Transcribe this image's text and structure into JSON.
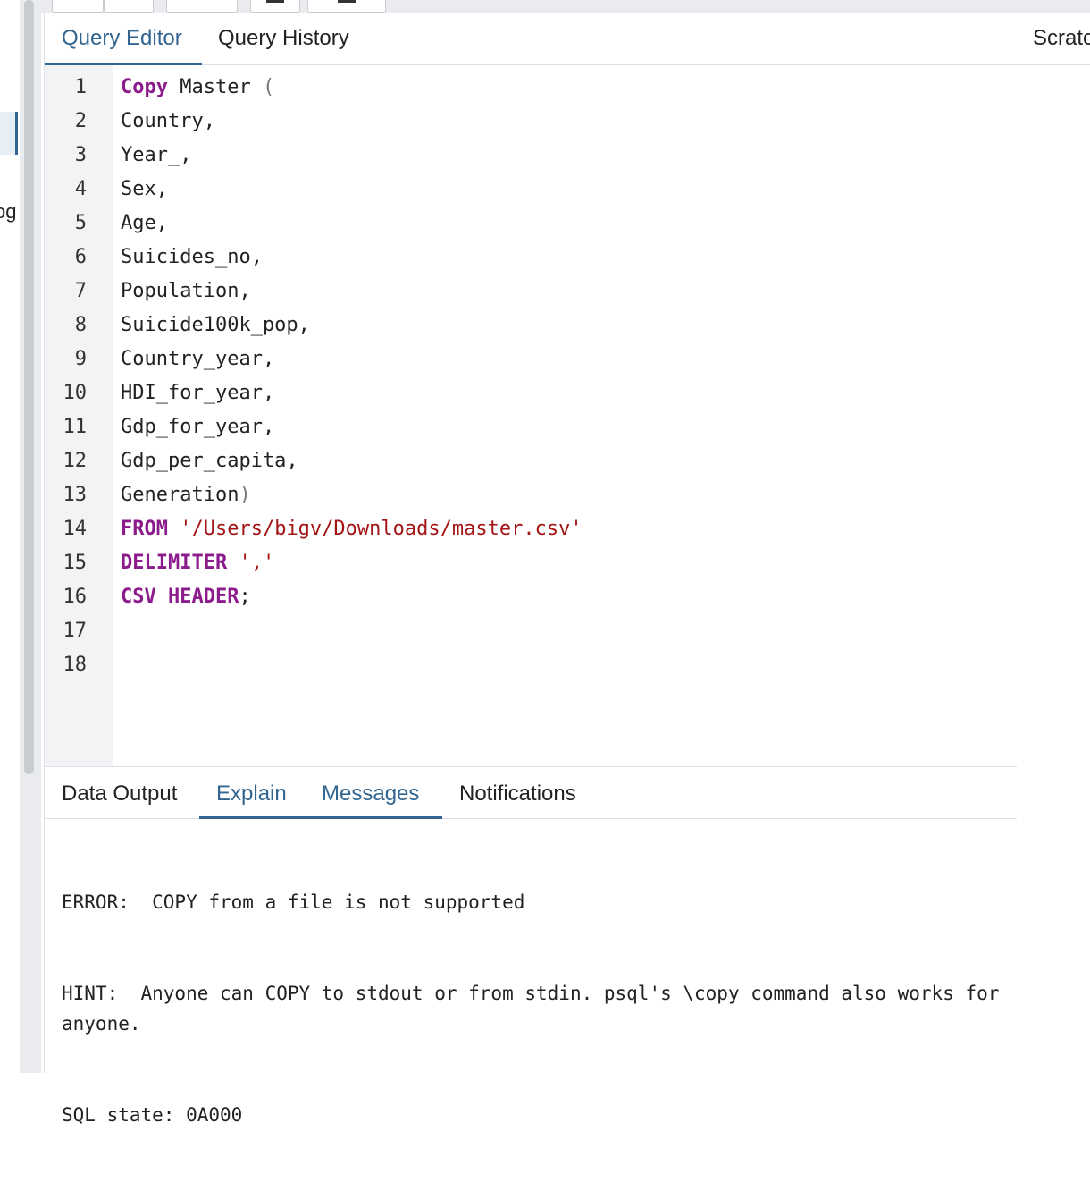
{
  "sidebar": {
    "partial_label": "og"
  },
  "tabs": [
    {
      "label": "Query Editor",
      "active": true
    },
    {
      "label": "Query History",
      "active": false
    }
  ],
  "scratch_pad": {
    "title": "Scratch Pad"
  },
  "editor": {
    "line_numbers": [
      "1",
      "2",
      "3",
      "4",
      "5",
      "6",
      "7",
      "8",
      "9",
      "10",
      "11",
      "12",
      "13",
      "14",
      "15",
      "16",
      "17",
      "18"
    ],
    "lines": [
      [
        {
          "t": "Copy",
          "c": "kw"
        },
        {
          "t": " Master ",
          "c": ""
        },
        {
          "t": "(",
          "c": "punc"
        }
      ],
      [
        {
          "t": "Country,",
          "c": ""
        }
      ],
      [
        {
          "t": "Year_,",
          "c": ""
        }
      ],
      [
        {
          "t": "Sex,",
          "c": ""
        }
      ],
      [
        {
          "t": "Age,",
          "c": ""
        }
      ],
      [
        {
          "t": "Suicides_no,",
          "c": ""
        }
      ],
      [
        {
          "t": "Population,",
          "c": ""
        }
      ],
      [
        {
          "t": "Suicide100k_pop,",
          "c": ""
        }
      ],
      [
        {
          "t": "Country_year,",
          "c": ""
        }
      ],
      [
        {
          "t": "HDI_for_year,",
          "c": ""
        }
      ],
      [
        {
          "t": "Gdp_for_year,",
          "c": ""
        }
      ],
      [
        {
          "t": "Gdp_per_capita,",
          "c": ""
        }
      ],
      [
        {
          "t": "Generation",
          "c": ""
        },
        {
          "t": ")",
          "c": "punc"
        }
      ],
      [
        {
          "t": "FROM",
          "c": "kw"
        },
        {
          "t": " ",
          "c": ""
        },
        {
          "t": "'/Users/bigv/Downloads/master.csv'",
          "c": "str"
        }
      ],
      [
        {
          "t": "DELIMITER",
          "c": "kw"
        },
        {
          "t": " ",
          "c": ""
        },
        {
          "t": "','",
          "c": "str"
        }
      ],
      [
        {
          "t": "CSV",
          "c": "kw"
        },
        {
          "t": " ",
          "c": ""
        },
        {
          "t": "HEADER",
          "c": "kw"
        },
        {
          "t": ";",
          "c": ""
        }
      ],
      [],
      []
    ]
  },
  "result_tabs": [
    {
      "label": "Data Output",
      "active": false
    },
    {
      "label": "Explain",
      "active": true
    },
    {
      "label": "Messages",
      "active": true
    },
    {
      "label": "Notifications",
      "active": false
    }
  ],
  "messages": {
    "error": "ERROR:  COPY from a file is not supported",
    "hint": "HINT:  Anyone can COPY to stdout or from stdin. psql's \\copy command also works for anyone.",
    "sql_state": "SQL state: 0A000"
  },
  "colors": {
    "accent": "#326690",
    "keyword": "#8c1b8c",
    "string": "#a31515",
    "gutter": "#f2f3f5"
  }
}
